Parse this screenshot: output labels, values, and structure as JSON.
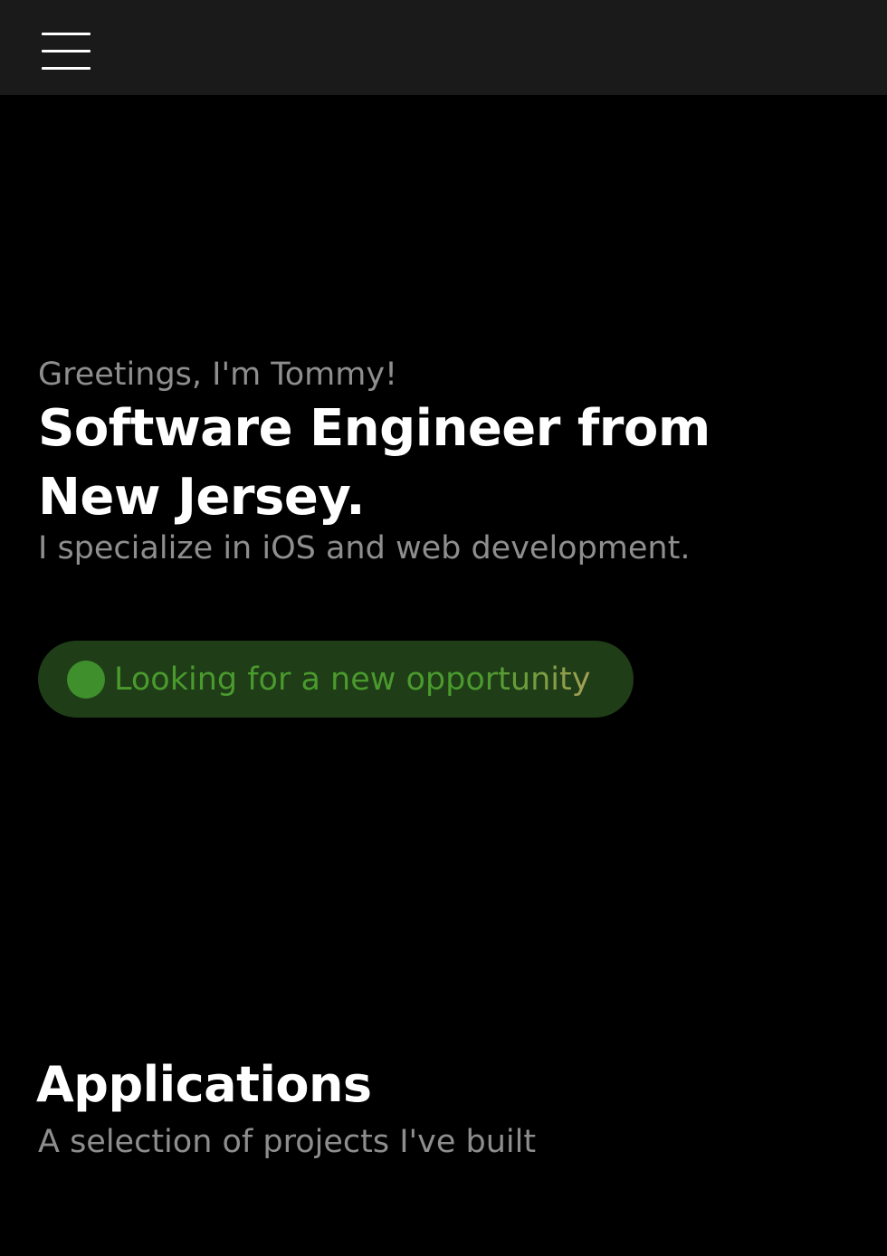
{
  "nav": {
    "menu_icon": "hamburger-menu-icon"
  },
  "hero": {
    "greeting": "Greetings, I'm Tommy!",
    "headline": "Software Engineer from New Jersey.",
    "tagline": "I specialize in iOS and web development."
  },
  "status": {
    "label": "Looking for a new opportunity",
    "dot_color": "#3f8f2c",
    "pill_color": "#1f3d17"
  },
  "applications": {
    "title": "Applications",
    "subtitle": "A selection of projects I've built"
  }
}
